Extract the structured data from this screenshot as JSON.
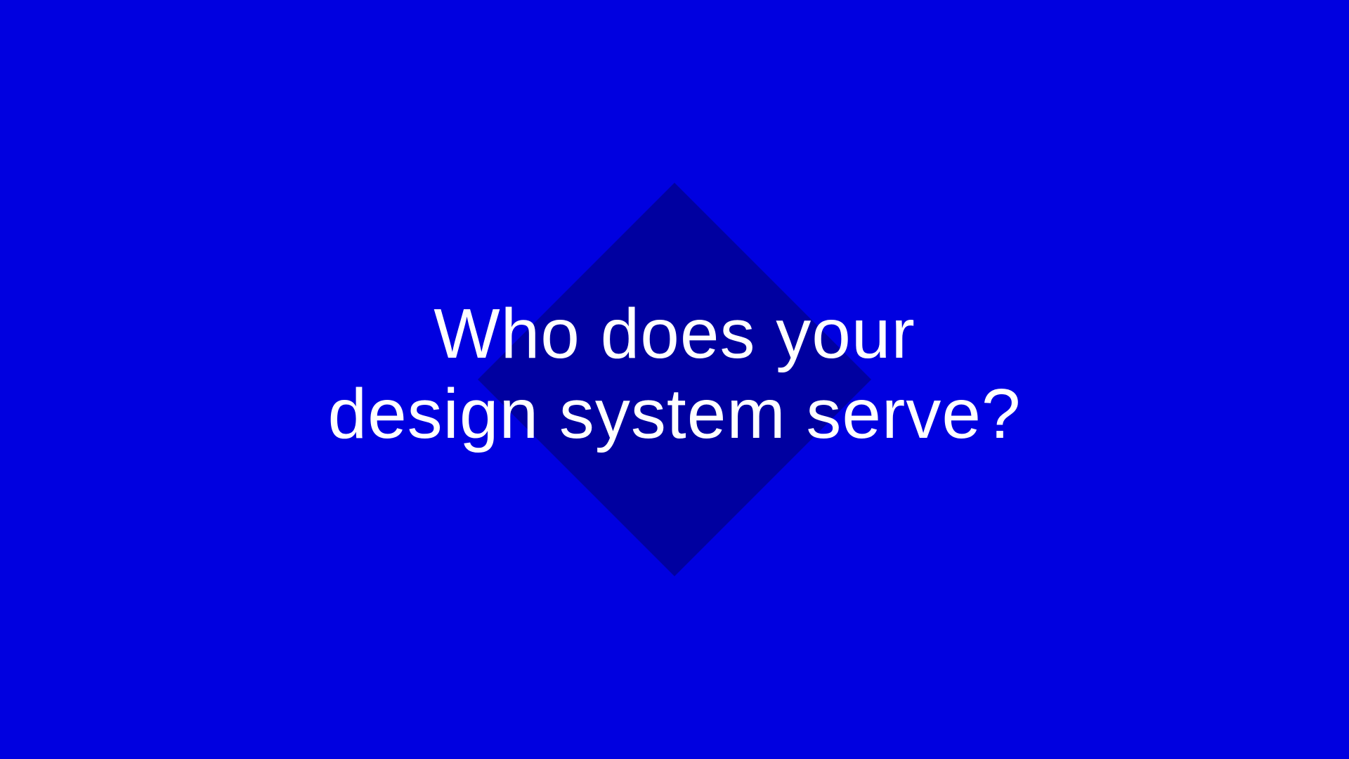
{
  "slide": {
    "background_color": "#0000E0",
    "shape_color": "#0000A0",
    "shape": "diamond",
    "headline": {
      "line1": "Who does your",
      "line2": "design system serve?"
    },
    "text_color": "#FFFFFF"
  }
}
